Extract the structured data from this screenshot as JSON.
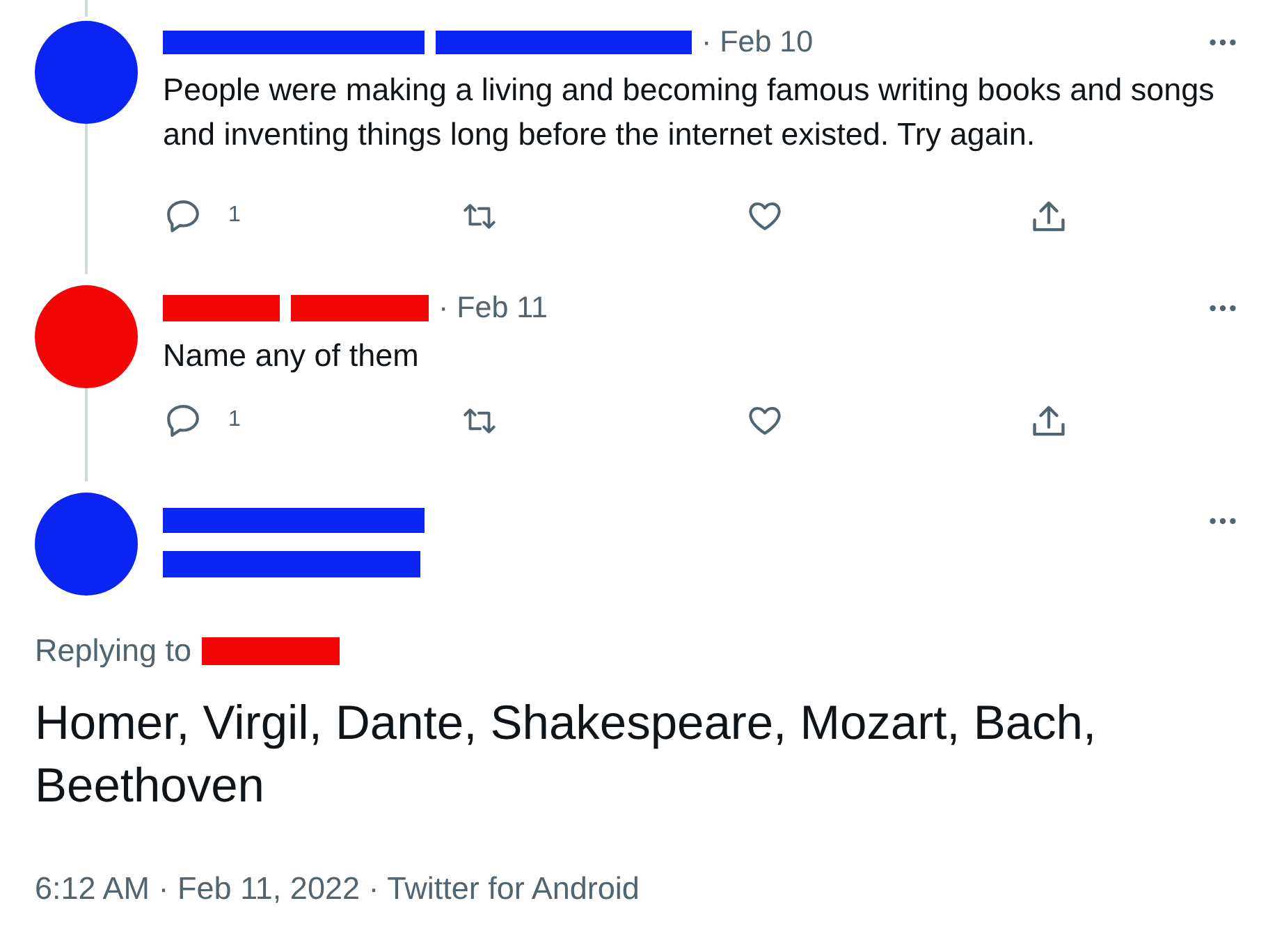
{
  "thread": [
    {
      "color": "#0b24f2",
      "date": "· Feb 10",
      "text": "People were making a living and becoming famous writing books and songs and inventing things long before the internet existed. Try again.",
      "actions": [
        {
          "kind": "reply",
          "count": "1"
        },
        {
          "kind": "retweet"
        },
        {
          "kind": "like"
        },
        {
          "kind": "share"
        }
      ]
    },
    {
      "color": "#f20606",
      "date": "· Feb 11",
      "text": "Name any of them",
      "actions": [
        {
          "kind": "reply",
          "count": "1"
        },
        {
          "kind": "retweet"
        },
        {
          "kind": "like"
        },
        {
          "kind": "share"
        }
      ]
    }
  ],
  "focused_tweet": {
    "color": "#0b24f2",
    "replying_to": {
      "label": "Replying to",
      "color": "#f20606"
    },
    "text": "Homer, Virgil, Dante, Shakespeare, Mozart, Bach, Beethoven",
    "timestamp": "6:12 AM · Feb 11, 2022 · Twitter for Android"
  }
}
